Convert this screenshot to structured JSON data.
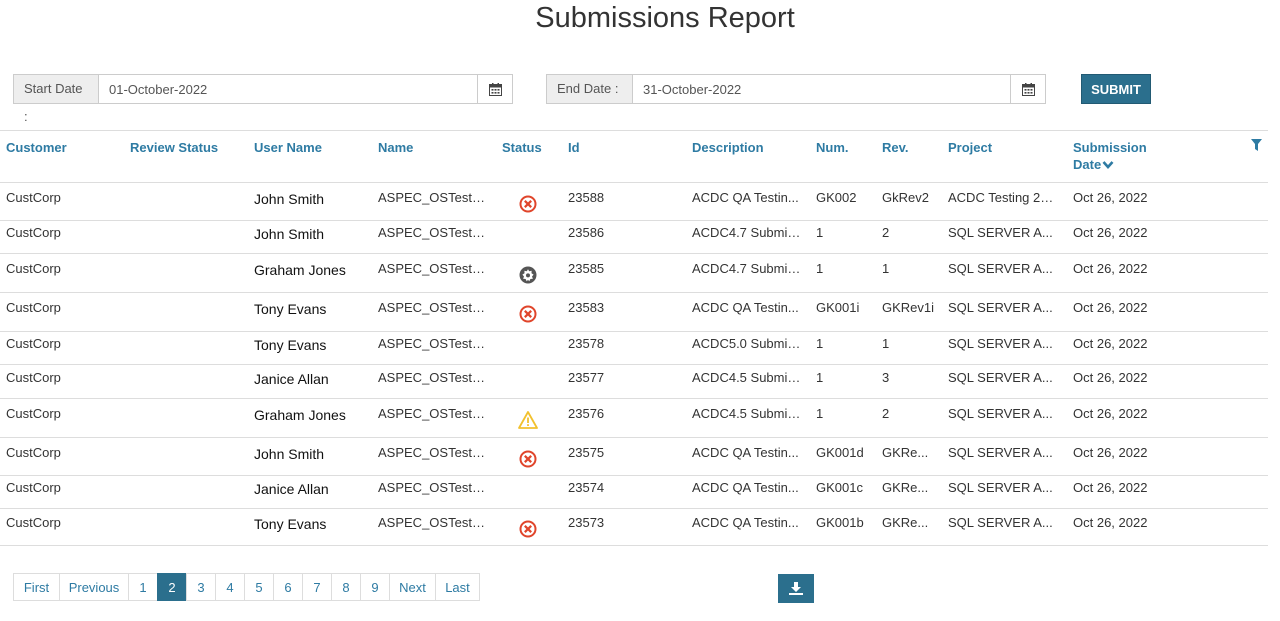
{
  "title": "Submissions Report",
  "filters": {
    "start_label": "Start Date :",
    "start_value": "01-October-2022",
    "end_label": "End Date :",
    "end_value": "31-October-2022",
    "submit_label": "SUBMIT"
  },
  "columns": {
    "customer": "Customer",
    "review_status": "Review Status",
    "user_name": "User Name",
    "name": "Name",
    "status": "Status",
    "id": "Id",
    "description": "Description",
    "num": "Num.",
    "rev": "Rev.",
    "project": "Project",
    "submission_date_line1": "Submission",
    "submission_date_line2": "Date"
  },
  "sort_icon": "chevron-down-icon",
  "filter_icon": "funnel-icon",
  "rows": [
    {
      "customer": "CustCorp",
      "review_status": "",
      "user_name": "John Smith",
      "name": "ASPEC_OSTest_...",
      "status": "error",
      "id": "23588",
      "description": "ACDC QA Testin...",
      "num": "GK002",
      "rev": "GkRev2",
      "project": "ACDC Testing 26...",
      "date": "Oct 26, 2022"
    },
    {
      "customer": "CustCorp",
      "review_status": "",
      "user_name": "John Smith",
      "name": "ASPEC_OSTest_...",
      "status": "",
      "id": "23586",
      "description": "ACDC4.7 Submis...",
      "num": "1",
      "rev": "2",
      "project": "SQL SERVER A...",
      "date": "Oct 26, 2022"
    },
    {
      "customer": "CustCorp",
      "review_status": "",
      "user_name": "Graham Jones",
      "name": "ASPEC_OSTest_...",
      "status": "gear",
      "id": "23585",
      "description": "ACDC4.7 Submis...",
      "num": "1",
      "rev": "1",
      "project": "SQL SERVER A...",
      "date": "Oct 26, 2022"
    },
    {
      "customer": "CustCorp",
      "review_status": "",
      "user_name": "Tony Evans",
      "name": "ASPEC_OSTest_...",
      "status": "error",
      "id": "23583",
      "description": "ACDC QA Testin...",
      "num": "GK001i",
      "rev": "GKRev1i",
      "project": "SQL SERVER A...",
      "date": "Oct 26, 2022"
    },
    {
      "customer": "CustCorp",
      "review_status": "",
      "user_name": "Tony Evans",
      "name": "ASPEC_OSTest_...",
      "status": "",
      "id": "23578",
      "description": "ACDC5.0 Submis...",
      "num": "1",
      "rev": "1",
      "project": "SQL SERVER A...",
      "date": "Oct 26, 2022"
    },
    {
      "customer": "CustCorp",
      "review_status": "",
      "user_name": "Janice Allan",
      "name": "ASPEC_OSTest_...",
      "status": "",
      "id": "23577",
      "description": "ACDC4.5 Submis...",
      "num": "1",
      "rev": "3",
      "project": "SQL SERVER A...",
      "date": "Oct 26, 2022"
    },
    {
      "customer": "CustCorp",
      "review_status": "",
      "user_name": "Graham Jones",
      "name": "ASPEC_OSTest_...",
      "status": "warning",
      "id": "23576",
      "description": "ACDC4.5 Submis...",
      "num": "1",
      "rev": "2",
      "project": "SQL SERVER A...",
      "date": "Oct 26, 2022"
    },
    {
      "customer": "CustCorp",
      "review_status": "",
      "user_name": "John Smith",
      "name": "ASPEC_OSTest_...",
      "status": "error",
      "id": "23575",
      "description": "ACDC QA Testin...",
      "num": "GK001d",
      "rev": "GKRe...",
      "project": "SQL SERVER A...",
      "date": "Oct 26, 2022"
    },
    {
      "customer": "CustCorp",
      "review_status": "",
      "user_name": "Janice Allan",
      "name": "ASPEC_OSTest_...",
      "status": "",
      "id": "23574",
      "description": "ACDC QA Testin...",
      "num": "GK001c",
      "rev": "GKRe...",
      "project": "SQL SERVER A...",
      "date": "Oct 26, 2022"
    },
    {
      "customer": "CustCorp",
      "review_status": "",
      "user_name": "Tony Evans",
      "name": "ASPEC_OSTest_...",
      "status": "error",
      "id": "23573",
      "description": "ACDC QA Testin...",
      "num": "GK001b",
      "rev": "GKRe...",
      "project": "SQL SERVER A...",
      "date": "Oct 26, 2022"
    }
  ],
  "pagination": {
    "first": "First",
    "previous": "Previous",
    "pages": [
      "1",
      "2",
      "3",
      "4",
      "5",
      "6",
      "7",
      "8",
      "9"
    ],
    "active": "2",
    "next": "Next",
    "last": "Last"
  },
  "download_icon": "download-icon",
  "colors": {
    "accent": "#2b6f8d",
    "link": "#2e7ba3",
    "error": "#e0452b",
    "warning": "#f2c12e",
    "gear": "#555555"
  }
}
